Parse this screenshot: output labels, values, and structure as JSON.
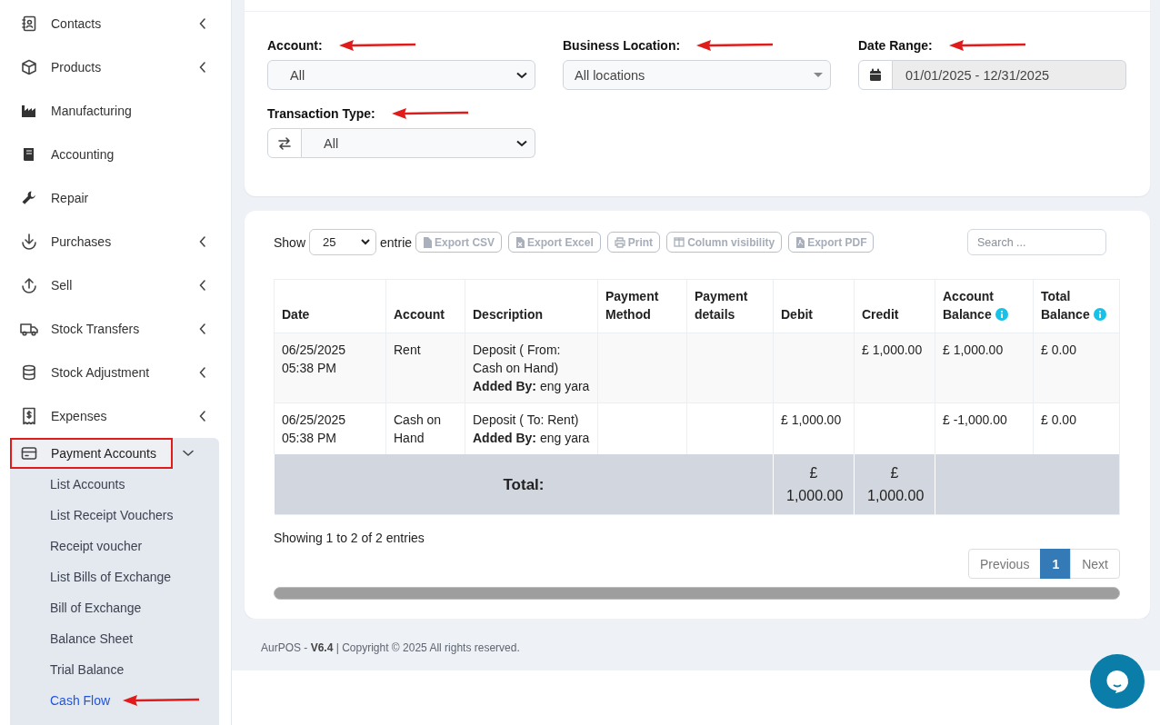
{
  "sidebar": {
    "items": [
      {
        "label": "Contacts",
        "kind": "collapsed"
      },
      {
        "label": "Products",
        "kind": "collapsed"
      },
      {
        "label": "Manufacturing",
        "kind": "plain"
      },
      {
        "label": "Accounting",
        "kind": "plain"
      },
      {
        "label": "Repair",
        "kind": "plain"
      },
      {
        "label": "Purchases",
        "kind": "collapsed"
      },
      {
        "label": "Sell",
        "kind": "collapsed"
      },
      {
        "label": "Stock Transfers",
        "kind": "collapsed"
      },
      {
        "label": "Stock Adjustment",
        "kind": "collapsed"
      },
      {
        "label": "Expenses",
        "kind": "collapsed"
      },
      {
        "label": "Payment Accounts",
        "kind": "expanded",
        "annotated": true,
        "children": [
          {
            "label": "List Accounts",
            "selected": false,
            "annotated": false
          },
          {
            "label": "List Receipt Vouchers",
            "selected": false,
            "annotated": false
          },
          {
            "label": "Receipt voucher",
            "selected": false,
            "annotated": false
          },
          {
            "label": "List Bills of Exchange",
            "selected": false,
            "annotated": false
          },
          {
            "label": "Bill of Exchange",
            "selected": false,
            "annotated": false
          },
          {
            "label": "Balance Sheet",
            "selected": false,
            "annotated": false
          },
          {
            "label": "Trial Balance",
            "selected": false,
            "annotated": false
          },
          {
            "label": "Cash Flow",
            "selected": true,
            "annotated": true
          }
        ]
      }
    ]
  },
  "filters": [
    {
      "label": "Account:",
      "kind": "select",
      "value": "All",
      "annotated": true
    },
    {
      "label": "Business Location:",
      "kind": "combo",
      "value": "All locations",
      "annotated": true
    },
    {
      "label": "Date Range:",
      "kind": "date",
      "value": "01/01/2025 - 12/31/2025",
      "annotated": true
    },
    {
      "label": "Transaction Type:",
      "kind": "addon-select",
      "value": "All",
      "annotated": true
    }
  ],
  "table": {
    "show_label": "Show",
    "page_length": "25",
    "entries_label": "entrie",
    "buttons": [
      "Export CSV",
      "Export Excel",
      "Print",
      "Column visibility",
      "Export PDF"
    ],
    "search": {
      "placeholder": "Search ..."
    },
    "columns": [
      {
        "label": "Date",
        "info": false
      },
      {
        "label": "Account",
        "info": false
      },
      {
        "label": "Description",
        "info": false
      },
      {
        "label": "Payment Method",
        "info": false
      },
      {
        "label": "Payment details",
        "info": false
      },
      {
        "label": "Debit",
        "info": false
      },
      {
        "label": "Credit",
        "info": false
      },
      {
        "label": "Account Balance",
        "info": true
      },
      {
        "label": "Total Balance",
        "info": true
      }
    ],
    "rows": [
      {
        "cells": [
          "06/25/2025 05:38 PM",
          "Rent",
          "Deposit ( From: Cash on Hand)\n**Added By:** eng yara",
          "",
          "",
          "",
          "£ 1,000.00",
          "£ 1,000.00",
          "£ 0.00"
        ]
      },
      {
        "cells": [
          "06/25/2025 05:38 PM",
          "Cash on Hand",
          "Deposit ( To: Rent)\n**Added By:** eng yara",
          "",
          "",
          "£ 1,000.00",
          "",
          "£ -1,000.00",
          "£ 0.00"
        ]
      }
    ],
    "total": {
      "label": "Total:",
      "debit": "£ 1,000.00",
      "credit": "£ 1,000.00"
    },
    "info": "Showing 1 to 2 of 2 entries",
    "pagination": [
      {
        "label": "Previous",
        "selected": false
      },
      {
        "label": "1",
        "selected": true
      },
      {
        "label": "Next",
        "selected": false
      }
    ]
  },
  "footer": {
    "text": "AurPOS - **V6.4** | Copyright © 2025 All rights reserved."
  }
}
